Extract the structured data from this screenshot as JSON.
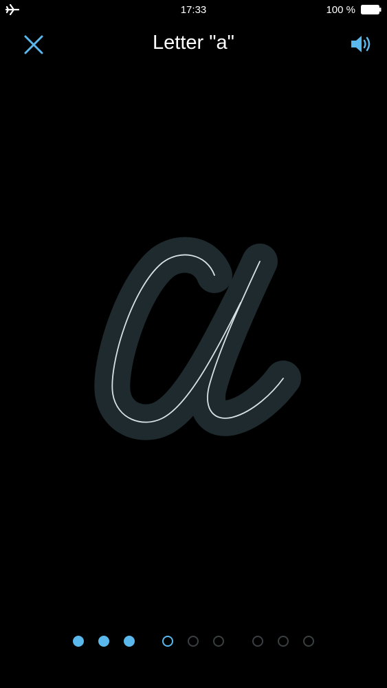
{
  "status_bar": {
    "time": "17:33",
    "battery": "100 %",
    "airplane_icon": "airplane-icon",
    "battery_icon": "battery-icon"
  },
  "header": {
    "title": "Letter \"a\"",
    "close_icon": "close-icon",
    "sound_icon": "speaker-icon"
  },
  "colors": {
    "accent": "#5ab8ec",
    "background": "#000000",
    "letter_track": "#1e2a2e",
    "guide_line": "#d8e2e4",
    "inactive_dot": "#3a3f42"
  },
  "pager": {
    "total": 9,
    "completed": 3,
    "current": 4,
    "states": [
      "done",
      "done",
      "done",
      "current",
      "todo",
      "todo",
      "todo",
      "todo",
      "todo"
    ]
  }
}
